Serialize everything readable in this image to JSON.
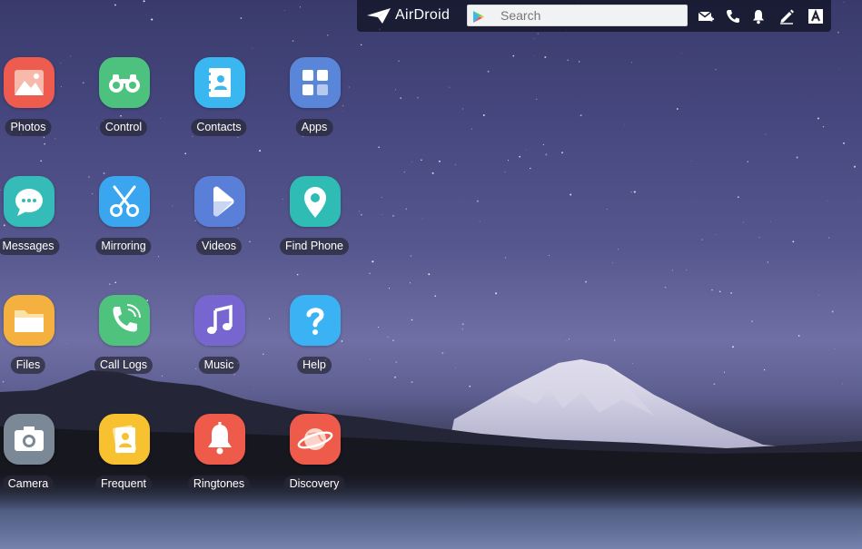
{
  "topbar": {
    "logo_text": "AirDroid",
    "search_placeholder": "Search",
    "icons": [
      "message-icon",
      "phone-icon",
      "notification-bell-icon",
      "edit-pen-icon",
      "font-a-icon"
    ]
  },
  "apps": [
    {
      "label": "Photos",
      "icon": "photos-icon",
      "color": "#ee5b4f"
    },
    {
      "label": "Control",
      "icon": "binoculars-icon",
      "color": "#4cc27e"
    },
    {
      "label": "Contacts",
      "icon": "contacts-book-icon",
      "color": "#3ab6f0"
    },
    {
      "label": "Apps",
      "icon": "apps-grid-icon",
      "color": "#5a86d9"
    },
    {
      "label": "Messages",
      "icon": "chat-bubble-icon",
      "color": "#35bcb9"
    },
    {
      "label": "Mirroring",
      "icon": "scissors-icon",
      "color": "#3aa6ef"
    },
    {
      "label": "Videos",
      "icon": "play-icon",
      "color": "#5a7fd8"
    },
    {
      "label": "Find Phone",
      "icon": "location-pin-icon",
      "color": "#2ebcb5"
    },
    {
      "label": "Files",
      "icon": "folder-icon",
      "color": "#f5b13f"
    },
    {
      "label": "Call Logs",
      "icon": "phone-call-icon",
      "color": "#4fc37d"
    },
    {
      "label": "Music",
      "icon": "music-note-icon",
      "color": "#7866d0"
    },
    {
      "label": "Help",
      "icon": "question-mark-icon",
      "color": "#3ab2f3"
    },
    {
      "label": "Camera",
      "icon": "camera-icon",
      "color": "#7b8895"
    },
    {
      "label": "Frequent",
      "icon": "frequent-contact-icon",
      "color": "#f7c12f"
    },
    {
      "label": "Ringtones",
      "icon": "bell-icon",
      "color": "#ee5b4a"
    },
    {
      "label": "Discovery",
      "icon": "planet-icon",
      "color": "#ee5b4a"
    }
  ]
}
